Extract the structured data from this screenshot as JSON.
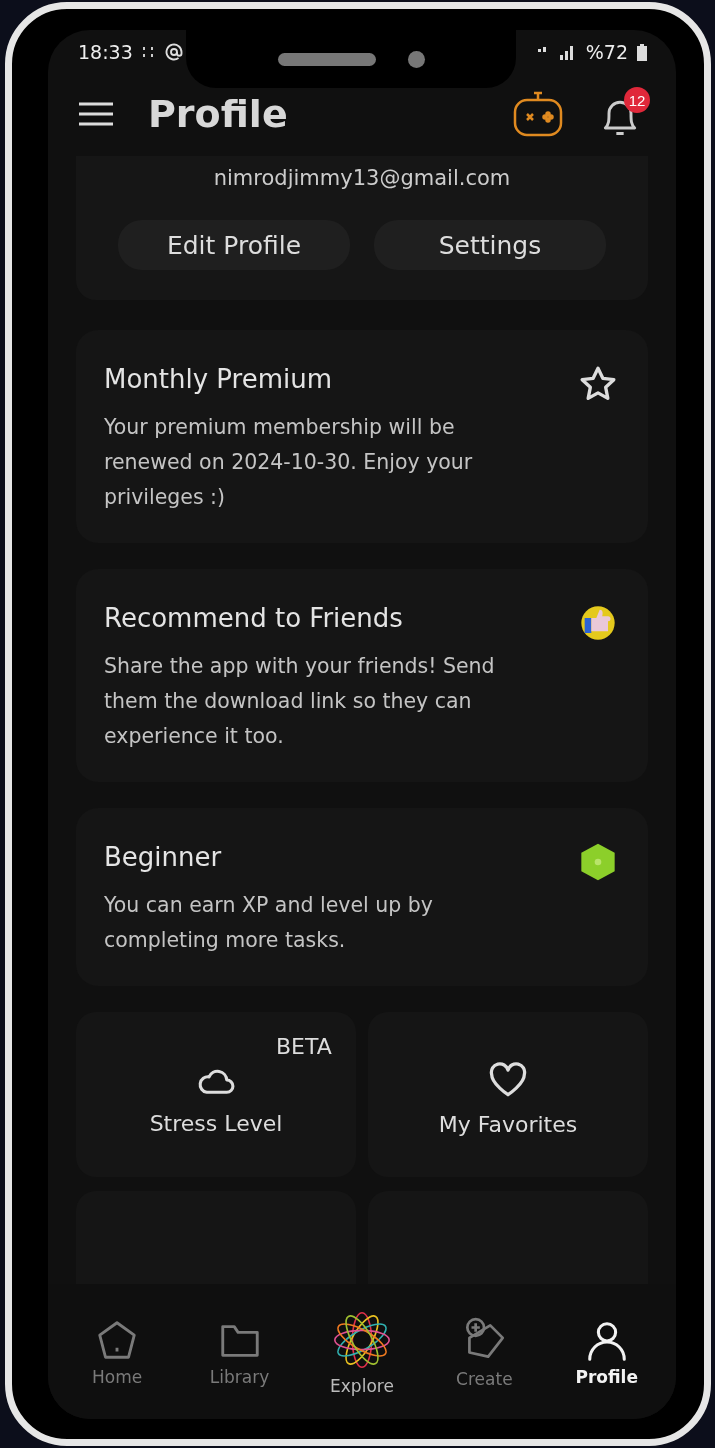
{
  "status_bar": {
    "time": "18:33",
    "battery": "%72"
  },
  "header": {
    "title": "Profile",
    "notification_count": "12"
  },
  "account": {
    "email": "nimrodjimmy13@gmail.com",
    "buttons": [
      "Edit Profile",
      "Settings"
    ]
  },
  "cards": [
    {
      "kind": "star",
      "title": "Monthly Premium",
      "text": "Your premium membership will be renewed on 2024-10-30. Enjoy your privileges :)"
    },
    {
      "kind": "thumbs-up",
      "title": "Recommend to Friends",
      "text": "Share the app with your friends! Send them the download link so they can experience it too."
    },
    {
      "kind": "hexagon",
      "title": "Beginner",
      "text": "You can earn XP and level up by completing more tasks."
    }
  ],
  "tiles": [
    {
      "kind": "cloud",
      "label": "Stress Level",
      "badge": "BETA"
    },
    {
      "kind": "heart",
      "label": "My Favorites"
    }
  ],
  "nav": [
    {
      "kind": "home",
      "label": "Home",
      "selected": false
    },
    {
      "kind": "library",
      "label": "Library",
      "selected": false
    },
    {
      "kind": "explore",
      "label": "Explore",
      "selected": false
    },
    {
      "kind": "create",
      "label": "Create",
      "selected": false
    },
    {
      "kind": "profile",
      "label": "Profile",
      "selected": true
    }
  ]
}
